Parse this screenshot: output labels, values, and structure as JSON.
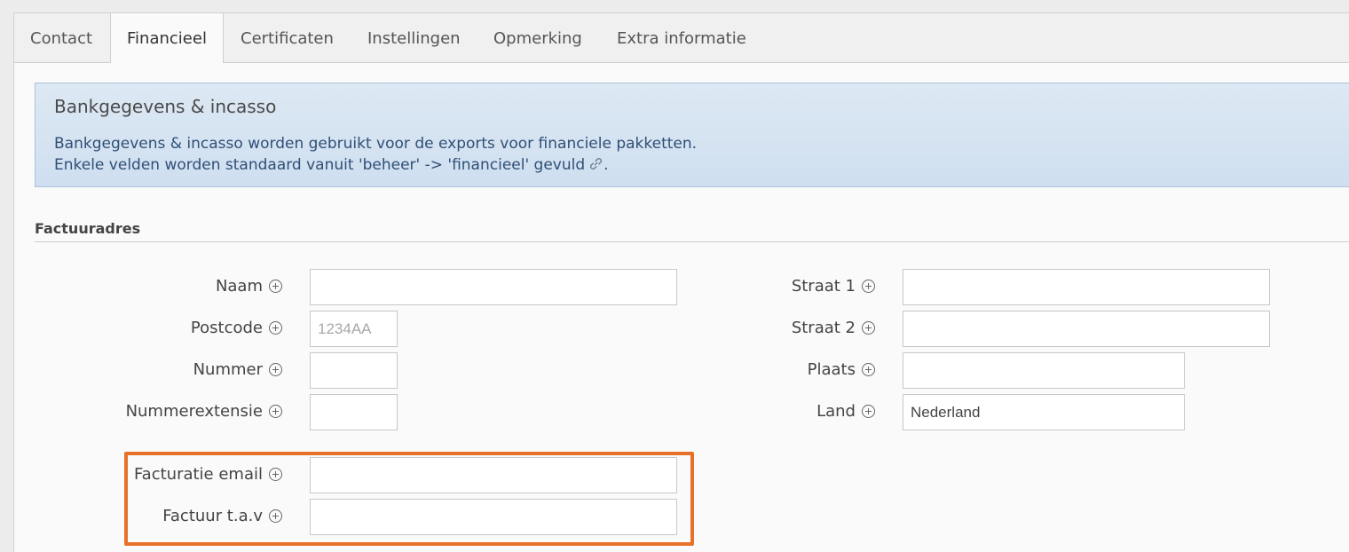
{
  "tabs": [
    {
      "label": "Contact"
    },
    {
      "label": "Financieel",
      "active": true
    },
    {
      "label": "Certificaten"
    },
    {
      "label": "Instellingen"
    },
    {
      "label": "Opmerking"
    },
    {
      "label": "Extra informatie"
    }
  ],
  "info": {
    "title": "Bankgegevens & incasso",
    "line1": "Bankgegevens & incasso worden gebruikt voor de exports voor financiele pakketten.",
    "line2": "Enkele velden worden standaard vanuit 'beheer' -> 'financieel' gevuld",
    "line2_end": "."
  },
  "section": {
    "title": "Factuuradres"
  },
  "fields": {
    "naam": {
      "label": "Naam",
      "value": "",
      "placeholder": ""
    },
    "postcode": {
      "label": "Postcode",
      "value": "",
      "placeholder": "1234AA"
    },
    "nummer": {
      "label": "Nummer",
      "value": "",
      "placeholder": ""
    },
    "nummerextensie": {
      "label": "Nummerextensie",
      "value": "",
      "placeholder": ""
    },
    "straat1": {
      "label": "Straat 1",
      "value": "",
      "placeholder": ""
    },
    "straat2": {
      "label": "Straat 2",
      "value": "",
      "placeholder": ""
    },
    "plaats": {
      "label": "Plaats",
      "value": "",
      "placeholder": ""
    },
    "land": {
      "label": "Land",
      "value": "Nederland",
      "placeholder": ""
    },
    "facturatie_email": {
      "label": "Facturatie email",
      "value": "",
      "placeholder": ""
    },
    "factuur_tav": {
      "label": "Factuur t.a.v",
      "value": "",
      "placeholder": ""
    }
  },
  "colors": {
    "highlight": "#e8712a",
    "info_bg": "#d6e4f2",
    "info_text": "#2f4f76"
  },
  "icons": {
    "add": "plus-circle-icon",
    "link": "link-icon"
  }
}
